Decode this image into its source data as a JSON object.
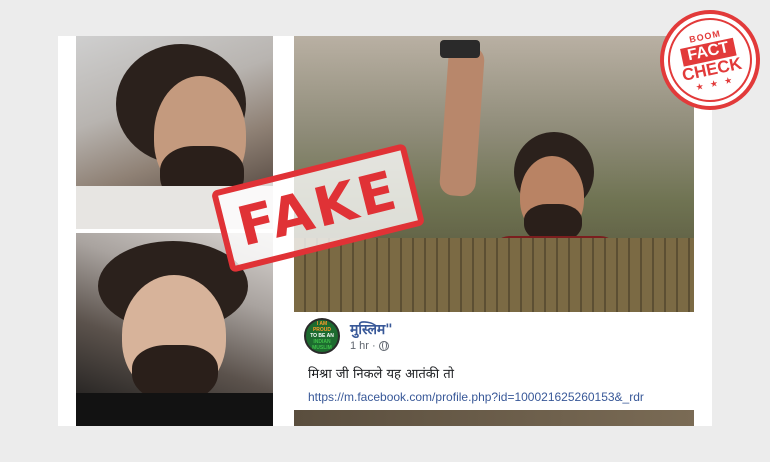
{
  "stamp": {
    "label": "FAKE",
    "color": "#e03236"
  },
  "badge": {
    "top": "BOOM",
    "fact": "FACT",
    "check": "CHECK",
    "stars": "★ ★ ★",
    "color": "#e23a3a"
  },
  "post": {
    "avatar_lines": [
      "I AM",
      "PROUD",
      "TO BE AN",
      "INDIAN",
      "MUSLIM"
    ],
    "name": "मुस्लिम\"",
    "time": "1 hr ·",
    "text": "मिश्रा जी निकले यह आतंकी तो",
    "link": "https://m.facebook.com/profile.php?id=100021625260153&_rdr",
    "name_color": "#385898"
  }
}
